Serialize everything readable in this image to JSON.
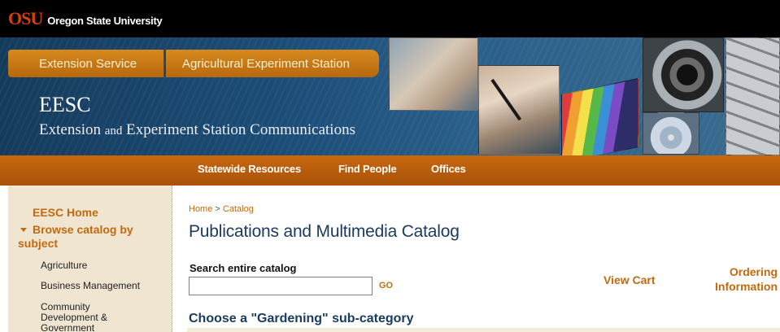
{
  "osu_bar": {
    "logo_mark": "OSU",
    "university_name": "Oregon State University"
  },
  "banner": {
    "tabs": [
      {
        "label": "Extension Service"
      },
      {
        "label": "Agricultural Experiment Station"
      }
    ],
    "title": "EESC",
    "subtitle_part1": "Extension",
    "subtitle_and": "and",
    "subtitle_part2": "Experiment Station Communications"
  },
  "nav": {
    "items": [
      {
        "label": "Statewide Resources"
      },
      {
        "label": "Find People"
      },
      {
        "label": "Offices"
      }
    ]
  },
  "sidebar": {
    "home_label": "EESC Home",
    "browse_label_line1": "Browse catalog by",
    "browse_label_line2": "subject",
    "subjects": [
      {
        "label": "Agriculture"
      },
      {
        "label": "Business Management"
      },
      {
        "label_line1": "Community",
        "label_line2": "Development &",
        "label_line3": "Government"
      }
    ]
  },
  "main": {
    "breadcrumb": {
      "home": "Home",
      "separator": ">",
      "current": "Catalog"
    },
    "title": "Publications and Multimedia Catalog",
    "search": {
      "label": "Search entire catalog",
      "value": "",
      "placeholder": "",
      "go_label": "GO"
    },
    "view_cart_label": "View Cart",
    "ordering_line1": "Ordering",
    "ordering_line2": "Information",
    "subcategory_heading": "Choose a \"Gardening\" sub-category"
  },
  "colors": {
    "osu_orange": "#d73f09",
    "nav_orange": "#c8680d",
    "link_orange": "#c26a0e",
    "title_blue": "#1a3a5e",
    "sidebar_bg": "#efe5d0"
  }
}
